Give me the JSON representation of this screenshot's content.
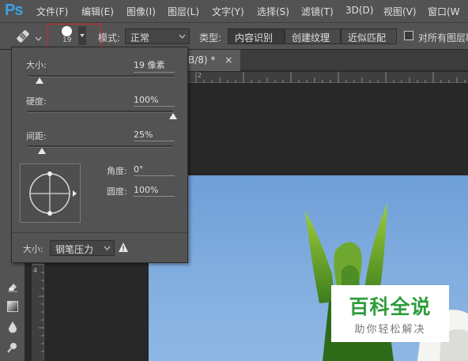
{
  "app": {
    "logo": "Ps"
  },
  "menu": [
    {
      "label": "文件(F)"
    },
    {
      "label": "编辑(E)"
    },
    {
      "label": "图像(I)"
    },
    {
      "label": "图层(L)"
    },
    {
      "label": "文字(Y)"
    },
    {
      "label": "选择(S)"
    },
    {
      "label": "滤镜(T)"
    },
    {
      "label": "3D(D)"
    },
    {
      "label": "视图(V)"
    },
    {
      "label": "窗口(W"
    }
  ],
  "options": {
    "brush_size": "19",
    "mode_label": "模式:",
    "mode_value": "正常",
    "type_label": "类型:",
    "type_buttons": [
      "内容识别",
      "创建纹理",
      "近似匹配"
    ],
    "sample_all_label": "对所有图层取"
  },
  "document": {
    "tab_label": "B/8) *",
    "close_symbol": "×",
    "ruler_top_label": "2",
    "ruler_left_labels": [
      "4"
    ]
  },
  "brush_panel": {
    "size_label": "大小:",
    "size_value": "19 像素",
    "size_fraction": 0.08,
    "hardness_label": "硬度:",
    "hardness_value": "100%",
    "hardness_fraction": 1.0,
    "spacing_label": "间距:",
    "spacing_value": "25%",
    "spacing_fraction": 0.1,
    "angle_label": "角度:",
    "angle_value": "0°",
    "roundness_label": "圆度:",
    "roundness_value": "100%",
    "pressure_label": "大小:",
    "pressure_value": "钢笔压力"
  },
  "watermark": {
    "title": "百科全说",
    "subtitle": "助你轻松解决"
  },
  "colors": {
    "accent": "#3ba2e8",
    "highlight": "#d2262b",
    "watermark_green": "#2e9d3c"
  },
  "icons": [
    "healing-brush-icon",
    "chevron-down-icon",
    "eraser-icon",
    "gradient-icon",
    "blur-drop-icon",
    "dodge-icon",
    "warning-icon",
    "close-icon"
  ]
}
